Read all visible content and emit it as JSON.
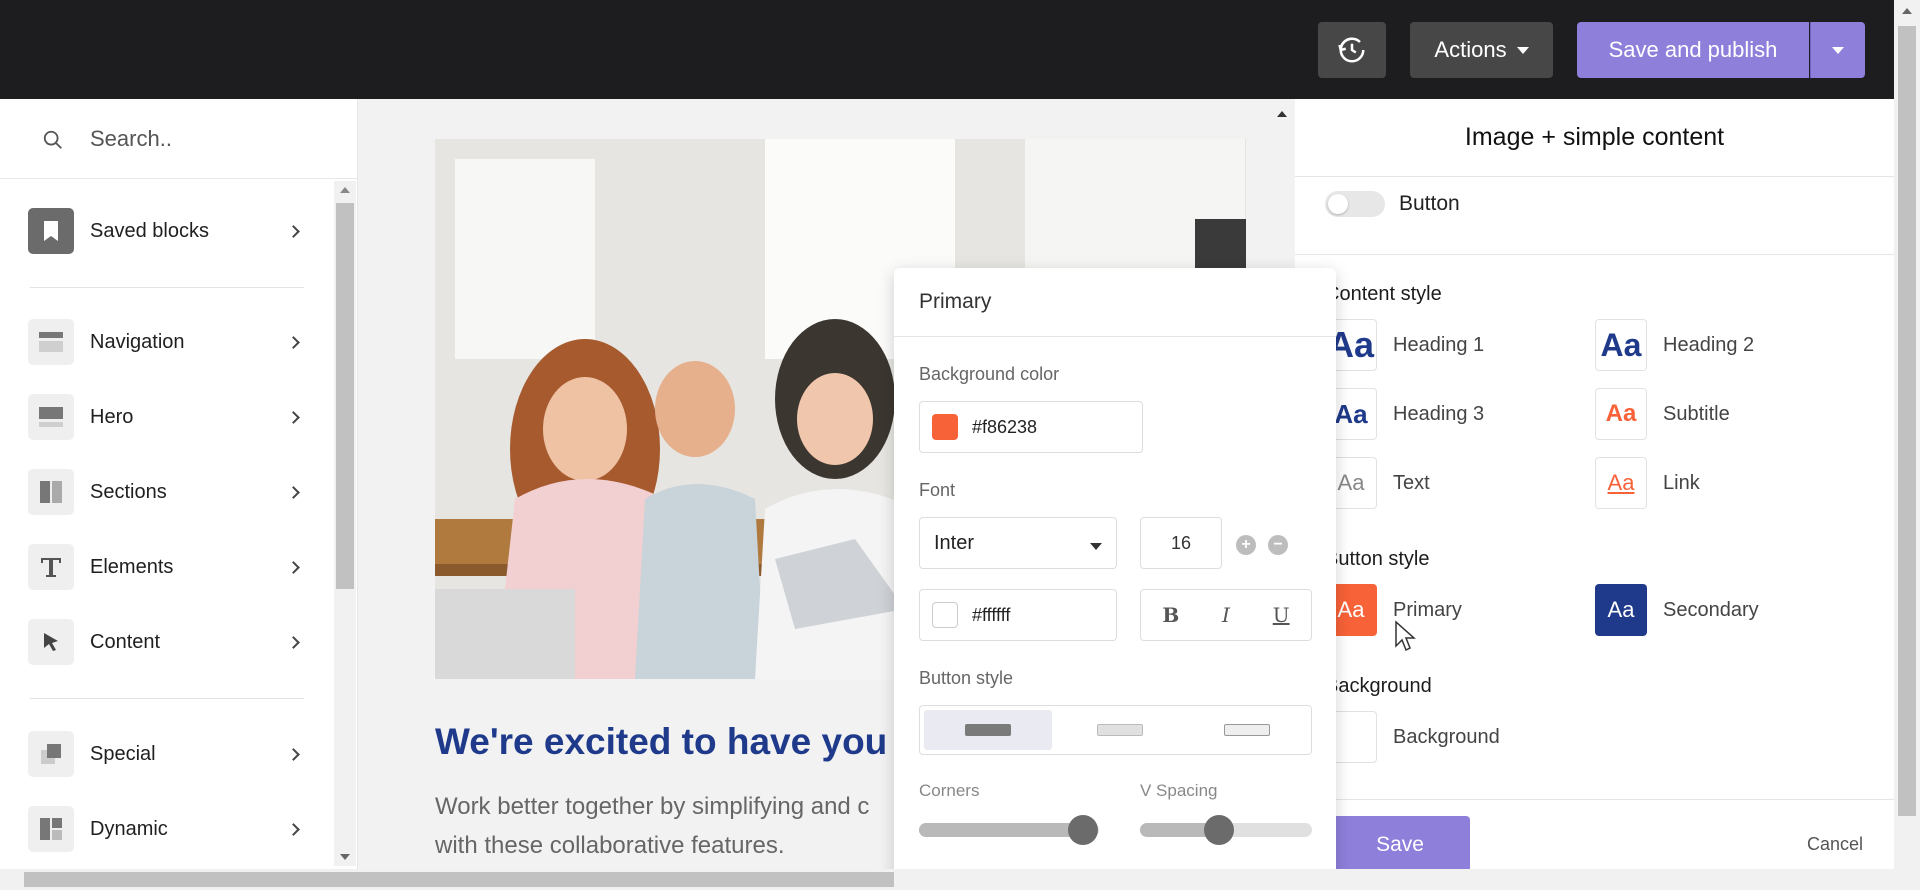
{
  "topbar": {
    "actions_label": "Actions",
    "publish_label": "Save and publish"
  },
  "sidebar": {
    "search_placeholder": "Search..",
    "items": [
      {
        "label": "Saved blocks",
        "icon": "bookmark-icon"
      },
      {
        "label": "Navigation",
        "icon": "navigation-block-icon"
      },
      {
        "label": "Hero",
        "icon": "hero-block-icon"
      },
      {
        "label": "Sections",
        "icon": "sections-block-icon"
      },
      {
        "label": "Elements",
        "icon": "text-t-icon"
      },
      {
        "label": "Content",
        "icon": "pointer-icon"
      },
      {
        "label": "Special",
        "icon": "special-block-icon"
      },
      {
        "label": "Dynamic",
        "icon": "dynamic-block-icon"
      }
    ]
  },
  "canvas": {
    "headline": "We're excited to have you a",
    "paragraph_line1": "Work better together by simplifying and c",
    "paragraph_line2": "with these collaborative features."
  },
  "rightpanel": {
    "title": "Image + simple content",
    "toggle_label": "Button",
    "content_style_heading": "Content style",
    "content_styles": [
      {
        "label": "Heading 1",
        "glyph": "Aa",
        "color": "#1f3a8a"
      },
      {
        "label": "Heading 2",
        "glyph": "Aa",
        "color": "#1f3a8a"
      },
      {
        "label": "Heading 3",
        "glyph": "Aa",
        "color": "#1f3a8a"
      },
      {
        "label": "Subtitle",
        "glyph": "Aa",
        "color": "#f86238"
      },
      {
        "label": "Text",
        "glyph": "Aa",
        "color": "#888888"
      },
      {
        "label": "Link",
        "glyph": "Aa",
        "color": "#f86238"
      }
    ],
    "button_style_heading": "Button style",
    "button_styles": [
      {
        "label": "Primary",
        "glyph": "Aa",
        "bg": "#f86238"
      },
      {
        "label": "Secondary",
        "glyph": "Aa",
        "bg": "#1f3a8a"
      }
    ],
    "background_heading": "Background",
    "background_label": "Background",
    "save_label": "Save",
    "cancel_label": "Cancel"
  },
  "popup": {
    "title": "Primary",
    "bg_color_label": "Background color",
    "bg_color_value": "#f86238",
    "font_label": "Font",
    "font_value": "Inter",
    "font_size": "16",
    "text_color_value": "#ffffff",
    "bold": "B",
    "italic": "I",
    "underline": "U",
    "button_style_label": "Button style",
    "corners_label": "Corners",
    "vspacing_label": "V Spacing",
    "corners_value": 0.91,
    "vspacing_value": 0.46
  },
  "colors": {
    "accent": "#8e7fdb",
    "brand_orange": "#f86238",
    "brand_navy": "#1f3a8a"
  }
}
